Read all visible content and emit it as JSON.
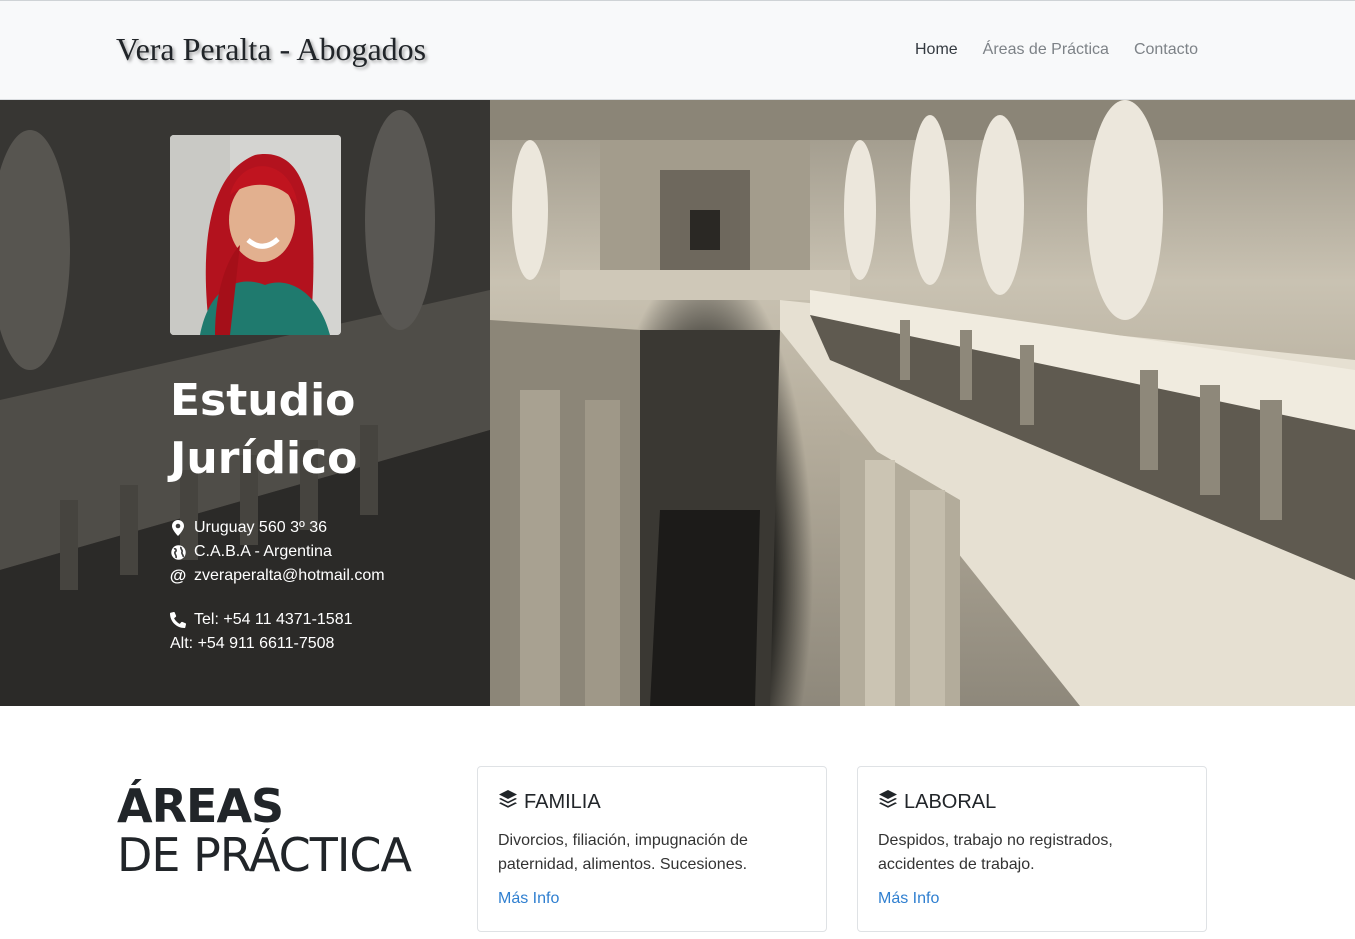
{
  "navbar": {
    "brand": "Vera Peralta - Abogados",
    "links": [
      {
        "label": "Home",
        "active": true
      },
      {
        "label": "Áreas de Práctica",
        "active": false
      },
      {
        "label": "Contacto",
        "active": false
      }
    ]
  },
  "hero": {
    "title_line1": "Estudio",
    "title_line2": "Jurídico",
    "contact": {
      "address": "Uruguay 560 3º 36",
      "city": "C.A.B.A - Argentina",
      "email": "zveraperalta@hotmail.com",
      "phone": "Tel: +54 11 4371-1581",
      "alt_phone": "Alt: +54 911 6611-7508"
    },
    "icons": [
      "map-marker-icon",
      "globe-icon",
      "at-icon",
      "phone-icon"
    ]
  },
  "areas": {
    "title_bold": "ÁREAS",
    "title_rest": "DE PRÁCTICA",
    "cards": [
      {
        "title": "FAMILIA",
        "text": "Divorcios, filiación, impugnación de paternidad, alimentos. Sucesiones.",
        "link": "Más Info"
      },
      {
        "title": "LABORAL",
        "text": "Despidos, trabajo no registrados, accidentes de trabajo.",
        "link": "Más Info"
      }
    ]
  },
  "colors": {
    "link": "#2f7fd0",
    "navbar_bg": "#f8f9fa",
    "overlay": "#1e1e1e"
  }
}
